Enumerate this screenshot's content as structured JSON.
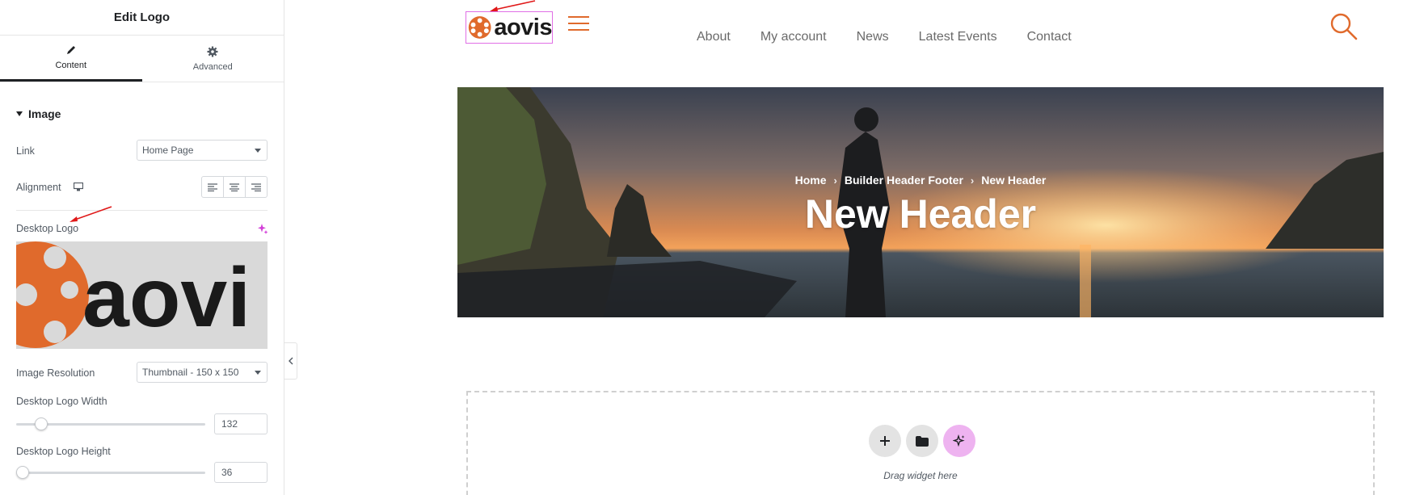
{
  "panel": {
    "title": "Edit Logo",
    "tabs": [
      {
        "label": "Content",
        "icon": "pencil-icon",
        "active": true
      },
      {
        "label": "Advanced",
        "icon": "gear-icon",
        "active": false
      }
    ],
    "section_title": "Image",
    "controls": {
      "link_label": "Link",
      "link_value": "Home Page",
      "alignment_label": "Alignment",
      "desktop_logo_label": "Desktop Logo",
      "image_resolution_label": "Image Resolution",
      "image_resolution_value": "Thumbnail - 150 x 150",
      "logo_width_label": "Desktop Logo Width",
      "logo_width_value": "132",
      "logo_height_label": "Desktop Logo Height",
      "logo_height_value": "36"
    },
    "logo_preview_text": "aovi"
  },
  "site": {
    "logo_text": "aovis",
    "nav": [
      "About",
      "My account",
      "News",
      "Latest Events",
      "Contact"
    ],
    "breadcrumb": [
      "Home",
      "Builder Header Footer",
      "New Header"
    ],
    "page_title": "New Header",
    "drop_zone_text": "Drag widget here"
  },
  "colors": {
    "accent": "#e06a2c",
    "selection": "#e06fe6",
    "ai_button": "#eeb3f0"
  }
}
